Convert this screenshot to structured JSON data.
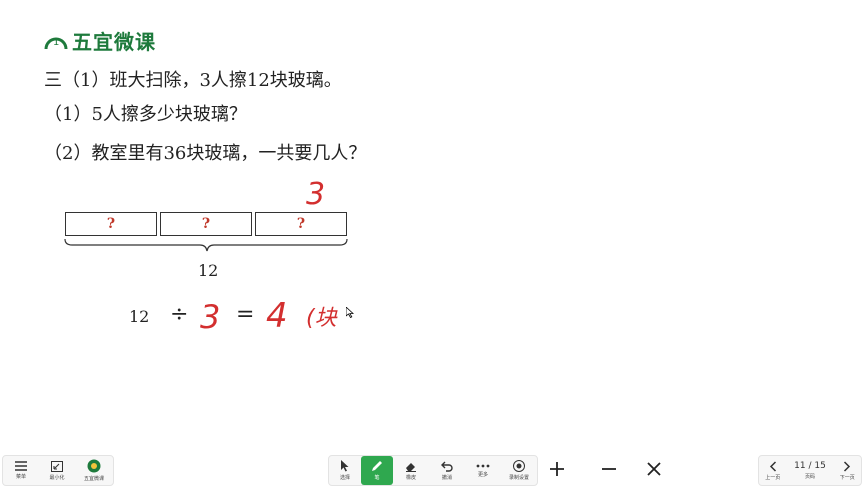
{
  "brand": {
    "name": "五宜微课",
    "mark_number": "1"
  },
  "problem": {
    "line1": "三（1）班大扫除，3人擦12块玻璃。",
    "line2": "（1）5人擦多少块玻璃？",
    "line3": "（2）教室里有36块玻璃，一共要几人？"
  },
  "diagram": {
    "boxes": [
      "?",
      "?",
      "?"
    ],
    "total": "12"
  },
  "equation": {
    "left": "12",
    "divide": "÷",
    "equals": "="
  },
  "handwriting": {
    "count": "3",
    "divisor": "3",
    "result": "4",
    "unit_partial": "(块"
  },
  "toolbar_left": {
    "menu_label": "菜单",
    "minimize_label": "最小化",
    "app_label": "五宜微课"
  },
  "toolbar_center": {
    "select_label": "选择",
    "pen_label": "笔",
    "eraser_label": "橡皮",
    "undo_label": "撤消",
    "more_label": "更多",
    "record_label": "录制设置"
  },
  "pager": {
    "prev_label": "上一页",
    "page_text": "11 / 15",
    "page_label": "页码",
    "next_label": "下一页"
  },
  "colors": {
    "ink": "#d32f2f",
    "brand": "#1e7a3c",
    "active_tool": "#2fa84f"
  }
}
